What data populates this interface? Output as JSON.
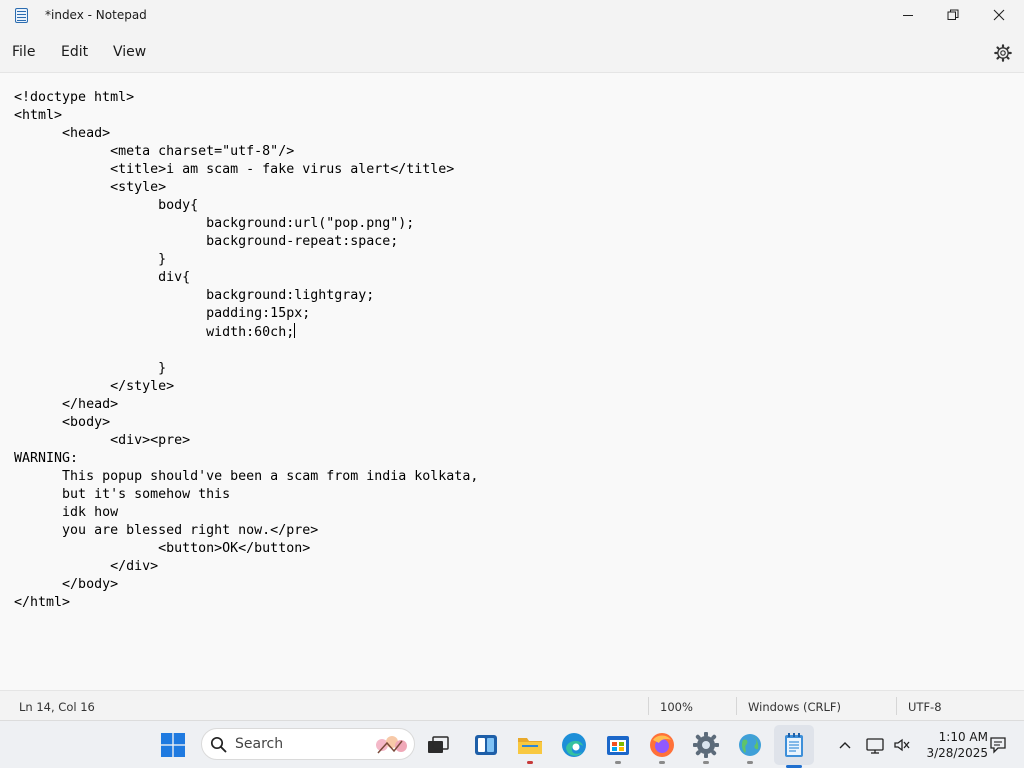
{
  "window": {
    "title": "*index - Notepad",
    "icons": [
      "notepad-icon",
      "minimize-icon",
      "restore-icon",
      "close-icon"
    ]
  },
  "menu": {
    "items": [
      "File",
      "Edit",
      "View"
    ],
    "settings_icon": "gear-icon"
  },
  "editor": {
    "lines": [
      "<!doctype html>",
      "<html>",
      "\t<head>",
      "\t\t<meta charset=\"utf-8\"/>",
      "\t\t<title>i am scam - fake virus alert</title>",
      "\t\t<style>",
      "\t\t\tbody{",
      "\t\t\t\tbackground:url(\"pop.png\");",
      "\t\t\t\tbackground-repeat:space;",
      "\t\t\t}",
      "\t\t\tdiv{",
      "\t\t\t\tbackground:lightgray;",
      "\t\t\t\tpadding:15px;",
      "\t\t\t\twidth:60ch;",
      "",
      "\t\t\t}",
      "\t\t</style>",
      "\t</head>",
      "\t<body>",
      "\t\t<div><pre>",
      "WARNING:",
      "\tThis popup should've been a scam from india kolkata,",
      "\tbut it's somehow this",
      "\tidk how",
      "\tyou are blessed right now.</pre>",
      "\t\t\t<button>OK</button>",
      "\t\t</div>",
      "\t</body>",
      "</html>"
    ],
    "caret_line_index": 13
  },
  "status": {
    "position": "Ln 14, Col 16",
    "zoom": "100%",
    "line_ending": "Windows (CRLF)",
    "encoding": "UTF-8"
  },
  "taskbar": {
    "search_placeholder": "Search",
    "apps": [
      "start-icon",
      "task-view-icon",
      "widgets-icon",
      "file-explorer-icon",
      "edge-icon",
      "store-icon",
      "firefox-icon",
      "settings-app-icon",
      "globe-app-icon",
      "notepad-taskbar-icon"
    ],
    "tray_icons": [
      "chevron-up-icon",
      "network-icon",
      "volume-icon",
      "notification-icon"
    ],
    "time": "1:10 AM",
    "date": "3/28/2025",
    "accent": "#1f6fcf"
  }
}
